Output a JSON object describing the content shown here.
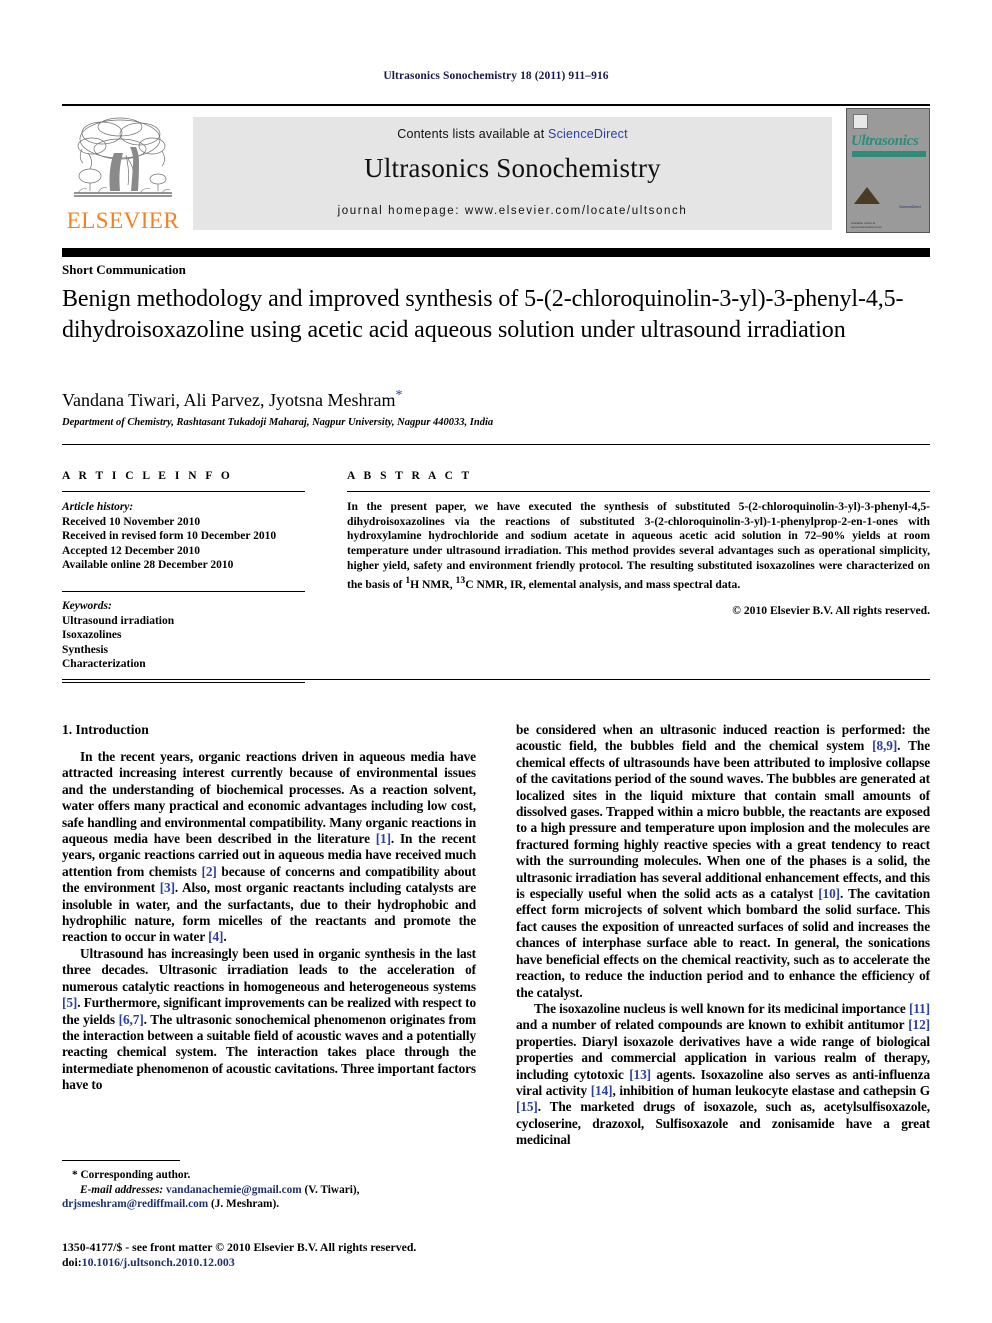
{
  "running_head": "Ultrasonics Sonochemistry 18 (2011) 911–916",
  "masthead": {
    "publisher_name": "ELSEVIER",
    "publisher_logo": "elsevier-tree-logo",
    "contents_prefix": "Contents lists available at ",
    "contents_link": "ScienceDirect",
    "journal_name": "Ultrasonics Sonochemistry",
    "homepage": "journal homepage: www.elsevier.com/locate/ultsonch",
    "cover": {
      "title": "Ultrasonics",
      "subtitle": "SONOCHEMISTRY",
      "sciencedirect": "ScienceDirect",
      "footer": "Available online at www.sciencedirect.com"
    }
  },
  "article": {
    "type": "Short Communication",
    "title": "Benign methodology and improved synthesis of 5-(2-chloroquinolin-3-yl)-3-phenyl-4,5-dihydroisoxazoline using acetic acid aqueous solution under ultrasound irradiation",
    "authors": "Vandana Tiwari, Ali Parvez, Jyotsna Meshram",
    "corresponding_marker": "*",
    "affiliation": "Department of Chemistry, Rashtasant Tukadoji Maharaj, Nagpur University, Nagpur 440033, India"
  },
  "article_info": {
    "heading": "A R T I C L E    I N F O",
    "history_label": "Article history:",
    "history": [
      "Received 10 November 2010",
      "Received in revised form 10 December 2010",
      "Accepted 12 December 2010",
      "Available online 28 December 2010"
    ],
    "keywords_label": "Keywords:",
    "keywords": [
      "Ultrasound irradiation",
      "Isoxazolines",
      "Synthesis",
      "Characterization"
    ]
  },
  "abstract": {
    "heading": "A B S T R A C T",
    "text": "In the present paper, we have executed the synthesis of substituted 5-(2-chloroquinolin-3-yl)-3-phenyl-4,5-dihydroisoxazolines via the reactions of substituted 3-(2-chloroquinolin-3-yl)-1-phenylprop-2-en-1-ones with hydroxylamine hydrochloride and sodium acetate in aqueous acetic acid solution in 72–90% yields at room temperature under ultrasound irradiation. This method provides several advantages such as operational simplicity, higher yield, safety and environment friendly protocol. The resulting substituted isoxazolines were characterized on the basis of 1H NMR, 13C NMR, IR, elemental analysis, and mass spectral data.",
    "copyright": "© 2010 Elsevier B.V. All rights reserved."
  },
  "body": {
    "section_heading": "1. Introduction",
    "left_paragraphs": [
      "In the recent years, organic reactions driven in aqueous media have attracted increasing interest currently because of environmental issues and the understanding of biochemical processes. As a reaction solvent, water offers many practical and economic advantages including low cost, safe handling and environmental compatibility. Many organic reactions in aqueous media have been described in the literature [1]. In the recent years, organic reactions carried out in aqueous media have received much attention from chemists [2] because of concerns and compatibility about the environment [3]. Also, most organic reactants including catalysts are insoluble in water, and the surfactants, due to their hydrophobic and hydrophilic nature, form micelles of the reactants and promote the reaction to occur in water [4].",
      "Ultrasound has increasingly been used in organic synthesis in the last three decades. Ultrasonic irradiation leads to the acceleration of numerous catalytic reactions in homogeneous and heterogeneous systems [5]. Furthermore, significant improvements can be realized with respect to the yields [6,7]. The ultrasonic sonochemical phenomenon originates from the interaction between a suitable field of acoustic waves and a potentially reacting chemical system. The interaction takes place through the intermediate phenomenon of acoustic cavitations. Three important factors have to"
    ],
    "right_paragraphs": [
      "be considered when an ultrasonic induced reaction is performed: the acoustic field, the bubbles field and the chemical system [8,9]. The chemical effects of ultrasounds have been attributed to implosive collapse of the cavitations period of the sound waves. The bubbles are generated at localized sites in the liquid mixture that contain small amounts of dissolved gases. Trapped within a micro bubble, the reactants are exposed to a high pressure and temperature upon implosion and the molecules are fractured forming highly reactive species with a great tendency to react with the surrounding molecules. When one of the phases is a solid, the ultrasonic irradiation has several additional enhancement effects, and this is especially useful when the solid acts as a catalyst [10]. The cavitation effect form microjects of solvent which bombard the solid surface. This fact causes the exposition of unreacted surfaces of solid and increases the chances of interphase surface able to react. In general, the sonications have beneficial effects on the chemical reactivity, such as to accelerate the reaction, to reduce the induction period and to enhance the efficiency of the catalyst.",
      "The isoxazoline nucleus is well known for its medicinal importance [11] and a number of related compounds are known to exhibit antitumor [12] properties. Diaryl isoxazole derivatives have a wide range of biological properties and commercial application in various realm of therapy, including cytotoxic [13] agents. Isoxazoline also serves as anti-influenza viral activity [14], inhibition of human leukocyte elastase and cathepsin G [15]. The marketed drugs of isoxazole, such as, acetylsulfisoxazole, cycloserine, drazoxol, Sulfisoxazole and zonisamide have a great medicinal"
    ]
  },
  "footnotes": {
    "corresponding": "* Corresponding author.",
    "email_label": "E-mail addresses:",
    "email1": "vandanachemie@gmail.com",
    "email1_person": "(V. Tiwari),",
    "email2": "drjsmeshram@rediffmail.com",
    "email2_person": "(J. Meshram)."
  },
  "imprint": {
    "issn_line": "1350-4177/$ - see front matter © 2010 Elsevier B.V. All rights reserved.",
    "doi_label": "doi:",
    "doi_value": "10.1016/j.ultsonch.2010.12.003"
  },
  "colors": {
    "elsevier_orange": "#f08223",
    "link_blue": "#2b3fa0",
    "runhead_navy": "#18194c",
    "cover_teal": "#2e8b7a",
    "grey_box": "#e5e5e5"
  }
}
